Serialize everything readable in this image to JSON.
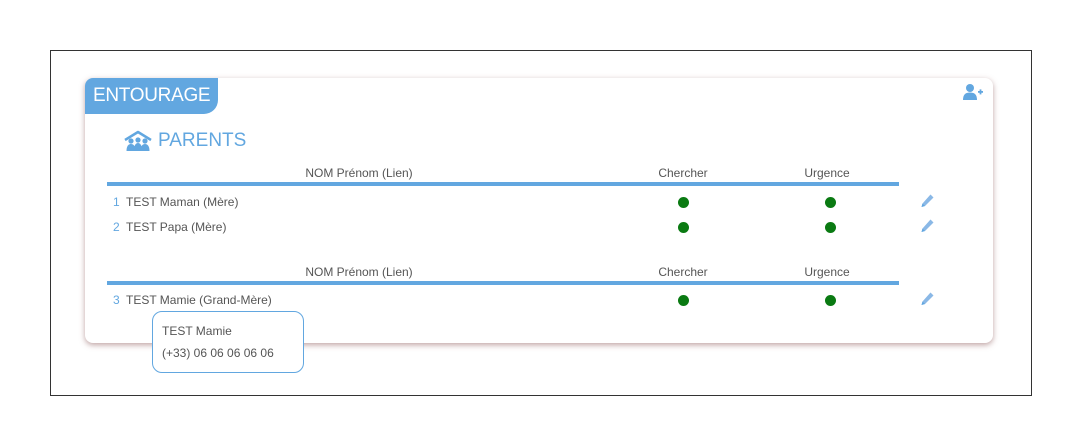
{
  "card": {
    "title": "ENTOURAGE",
    "add_icon": "add-user-icon"
  },
  "section": {
    "title": "PARENTS",
    "icon": "family-house-icon"
  },
  "colors": {
    "accent": "#62a7e0",
    "status_on": "#0a7a12",
    "text": "#555555"
  },
  "tables": [
    {
      "headers": {
        "name": "NOM Prénom (Lien)",
        "search": "Chercher",
        "urgency": "Urgence"
      },
      "rows": [
        {
          "num": "1",
          "name": "TEST Maman (Mère)",
          "search": true,
          "urgency": true
        },
        {
          "num": "2",
          "name": "TEST Papa (Mère)",
          "search": true,
          "urgency": true
        }
      ]
    },
    {
      "headers": {
        "name": "NOM Prénom (Lien)",
        "search": "Chercher",
        "urgency": "Urgence"
      },
      "rows": [
        {
          "num": "3",
          "name": "TEST Mamie (Grand-Mère)",
          "search": true,
          "urgency": true
        }
      ]
    }
  ],
  "tooltip": {
    "name": "TEST Mamie",
    "phone": "(+33) 06 06 06 06 06"
  }
}
